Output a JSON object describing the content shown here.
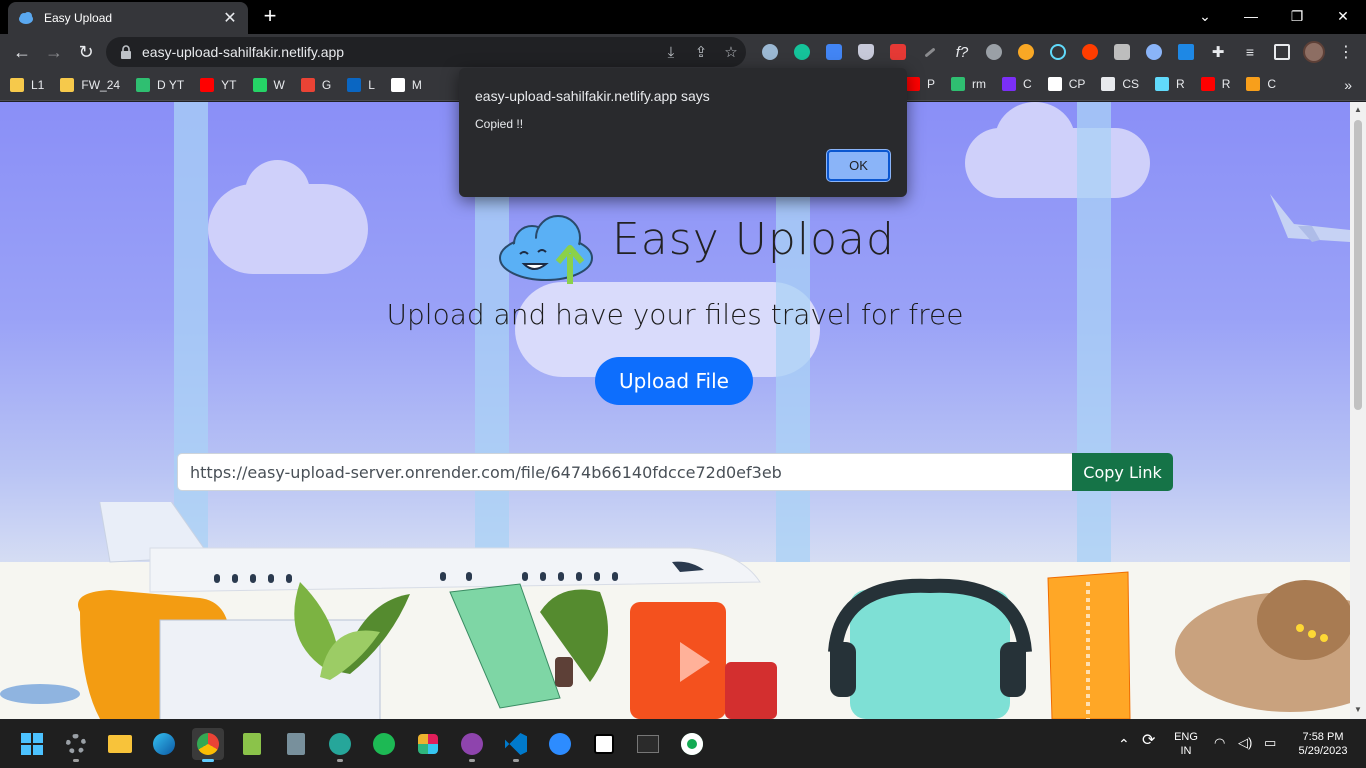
{
  "browser": {
    "tab_title": "Easy Upload",
    "tab_close": "✕",
    "new_tab": "+",
    "url": "easy-upload-sahilfakir.netlify.app",
    "bookmarks": [
      {
        "label": "L1",
        "color": "#f6c94b"
      },
      {
        "label": "FW_24",
        "color": "#f6c94b"
      },
      {
        "label": "D YT",
        "color": "#2fbf71"
      },
      {
        "label": "YT",
        "color": "#ff0000"
      },
      {
        "label": "W",
        "color": "#25d366"
      },
      {
        "label": "G",
        "color": "#ea4335"
      },
      {
        "label": "L",
        "color": "#0a66c2"
      },
      {
        "label": "M",
        "color": "#ffffff"
      }
    ],
    "bookmarks_right": [
      {
        "label": "P",
        "color": "#ff0000"
      },
      {
        "label": "rm",
        "color": "#2fbf71"
      },
      {
        "label": "C",
        "color": "#7b2ff7"
      },
      {
        "label": "CP",
        "color": "#ffffff"
      },
      {
        "label": "CS",
        "color": "#e8eaed"
      },
      {
        "label": "R",
        "color": "#61dafb"
      },
      {
        "label": "R",
        "color": "#ff0000"
      },
      {
        "label": "C",
        "color": "#f89f1b"
      }
    ],
    "bookmarks_more": "»"
  },
  "app": {
    "title": "Easy Upload",
    "tagline": "Upload and have your files travel for free",
    "upload_button": "Upload File",
    "link_value": "https://easy-upload-server.onrender.com/file/6474b66140fdcce72d0ef3eb",
    "copy_button": "Copy Link"
  },
  "dialog": {
    "title": "easy-upload-sahilfakir.netlify.app says",
    "message": "Copied !!",
    "ok": "OK"
  },
  "taskbar": {
    "lang_top": "ENG",
    "lang_bottom": "IN",
    "time": "7:58 PM",
    "date": "5/29/2023"
  }
}
